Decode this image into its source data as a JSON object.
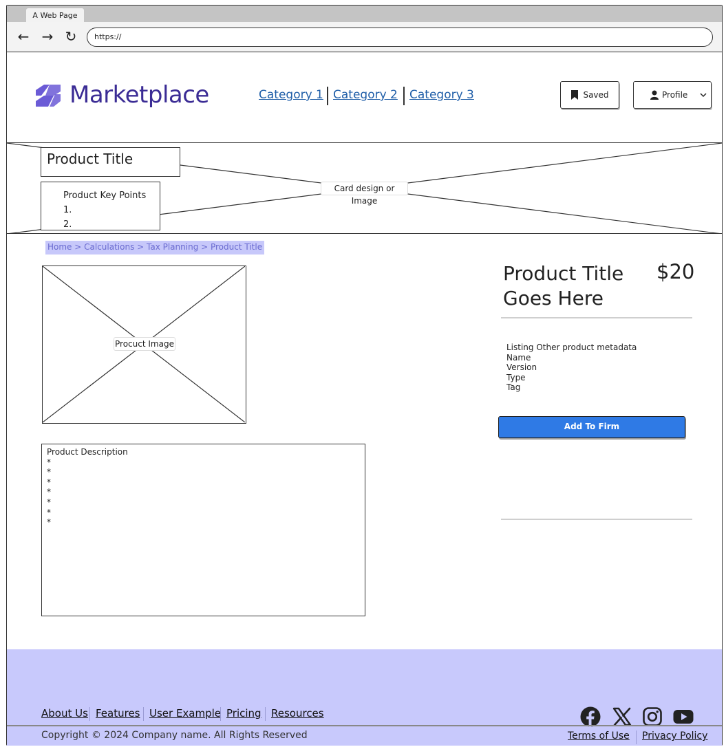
{
  "browser": {
    "tab_title": "A Web Page",
    "url": "https://",
    "back_icon": "arrow-left-icon",
    "forward_icon": "arrow-right-icon",
    "reload_icon": "reload-icon"
  },
  "header": {
    "logo_text": "Marketplace",
    "categories": [
      "Category 1",
      "Category 2",
      "Category 3"
    ],
    "saved_label": "Saved",
    "profile_label": "Profile"
  },
  "hero": {
    "title": "Product Title",
    "key_points_heading": "Product Key Points",
    "key_points": [
      "1.",
      "2."
    ],
    "placeholder_label": "Card design or Image"
  },
  "breadcrumb": "Home > Calculations >  Tax Planning > Product Title",
  "product": {
    "image_label": "Procuct Image",
    "title": "Product Title Goes Here",
    "price": "$20",
    "metadata": [
      "Listing Other product metadata",
      "Name",
      "Version",
      "Type",
      "Tag"
    ],
    "add_label": "Add To Firm",
    "description_heading": "Product Description",
    "description_bullets": [
      "*",
      "*",
      "*",
      "*",
      "*",
      "*",
      "*"
    ]
  },
  "footer": {
    "links": [
      "About Us",
      "Features",
      "User Example",
      "Pricing",
      "Resources"
    ],
    "copyright": "Copyright © 2024 Company name. All Rights Reserved",
    "legal_links": [
      "Terms of Use",
      "Privacy Policy"
    ],
    "social_icons": [
      "facebook-icon",
      "x-icon",
      "instagram-icon",
      "youtube-icon"
    ]
  },
  "colors": {
    "accent_blue": "#2f7ae5",
    "logo_purple": "#3b2c95",
    "logo_mark": "#6b5bd6",
    "footer_bg": "#c8c9fc",
    "breadcrumb_bg": "#c7c8fa",
    "link_blue": "#1f5ea8"
  }
}
